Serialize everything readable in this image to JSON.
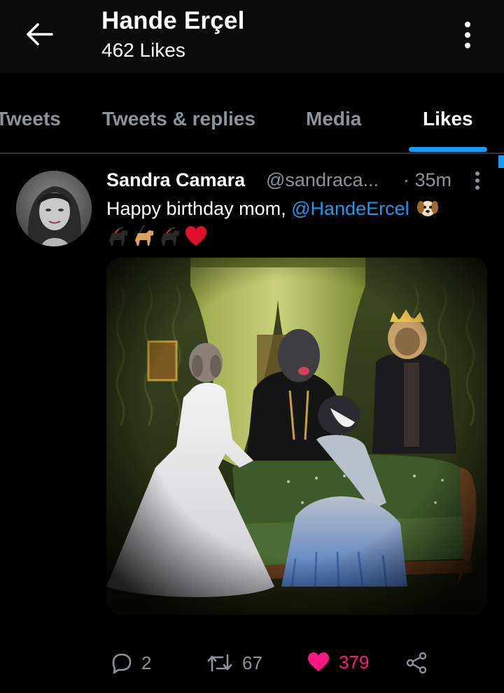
{
  "header": {
    "title": "Hande Erçel",
    "subtitle": "462 Likes"
  },
  "tabs": [
    {
      "label": "Tweets",
      "active": false
    },
    {
      "label": "Tweets & replies",
      "active": false
    },
    {
      "label": "Media",
      "active": false
    },
    {
      "label": "Likes",
      "active": true
    }
  ],
  "tweet": {
    "author_name": "Sandra Camara",
    "author_handle": "@sandraca...",
    "time": "· 35m",
    "text_prefix": "Happy birthday mom, ",
    "mention": "@HandeErcel",
    "emojis": [
      "dog-face-emoji",
      "black-dog-emoji",
      "guide-dog-emoji",
      "black-dog-emoji",
      "red-heart-emoji"
    ],
    "media_description_icon": "photo-painting",
    "actions": {
      "replies": "2",
      "retweets": "67",
      "likes": "379"
    }
  },
  "colors": {
    "accent": "#1d9bf0",
    "like": "#f91880",
    "muted": "#8b949b"
  }
}
